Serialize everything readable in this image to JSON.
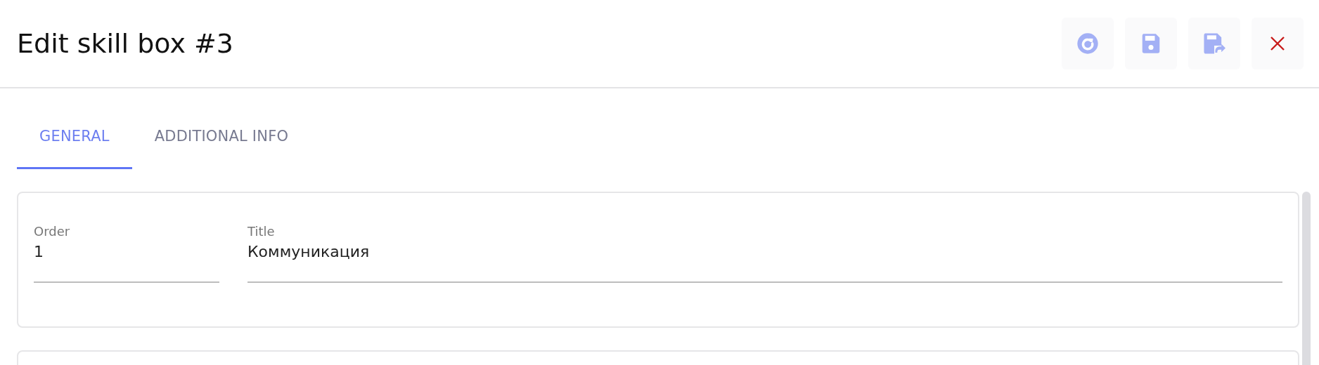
{
  "header": {
    "title": "Edit skill box #3",
    "actions": [
      {
        "kind": "refresh"
      },
      {
        "kind": "save"
      },
      {
        "kind": "save-and-close"
      },
      {
        "kind": "close"
      }
    ]
  },
  "tabs": [
    {
      "label": "GENERAL",
      "selected": true
    },
    {
      "label": "ADDITIONAL INFO",
      "selected": false
    }
  ],
  "fields": [
    {
      "kind": "short",
      "label": "Order",
      "value": "1"
    },
    {
      "kind": "wide",
      "label": "Title",
      "value": "Коммуникация"
    }
  ]
}
